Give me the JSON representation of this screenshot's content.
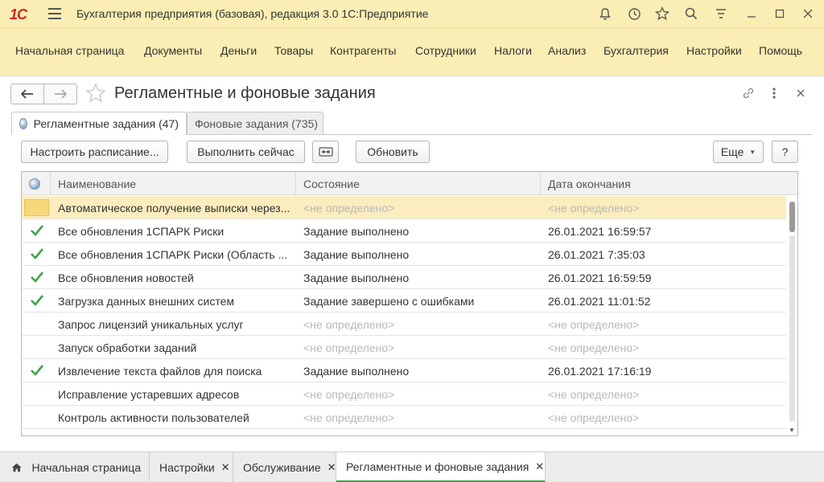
{
  "app": {
    "logo": "1С",
    "title": "Бухгалтерия предприятия (базовая), редакция 3.0 1С:Предприятие"
  },
  "mainmenu": {
    "items": [
      "Начальная страница",
      "Документы",
      "Деньги",
      "Товары",
      "Контрагенты",
      "Сотрудники",
      "Налоги",
      "Анализ",
      "Бухгалтерия",
      "Настройки",
      "Помощь"
    ]
  },
  "page": {
    "title": "Регламентные и фоновые задания"
  },
  "tabs": [
    {
      "label": "Регламентные задания (47)",
      "active": true
    },
    {
      "label": "Фоновые задания (735)",
      "active": false
    }
  ],
  "toolbar": {
    "schedule_label": "Настроить расписание...",
    "run_now_label": "Выполнить сейчас",
    "refresh_label": "Обновить",
    "more_label": "Еще",
    "help_label": "?"
  },
  "table": {
    "columns": [
      "Наименование",
      "Состояние",
      "Дата окончания"
    ],
    "rows": [
      {
        "done": false,
        "selected": true,
        "name": "Автоматическое получение выписки через...",
        "state": "<не определено>",
        "date": "<не определено>"
      },
      {
        "done": true,
        "selected": false,
        "name": "Все обновления 1СПАРК Риски",
        "state": "Задание выполнено",
        "date": "26.01.2021 16:59:57"
      },
      {
        "done": true,
        "selected": false,
        "name": "Все обновления 1СПАРК Риски (Область ...",
        "state": "Задание выполнено",
        "date": "26.01.2021 7:35:03"
      },
      {
        "done": true,
        "selected": false,
        "name": "Все обновления новостей",
        "state": "Задание выполнено",
        "date": "26.01.2021 16:59:59"
      },
      {
        "done": true,
        "selected": false,
        "name": "Загрузка данных внешних систем",
        "state": "Задание завершено с ошибками",
        "date": "26.01.2021 11:01:52"
      },
      {
        "done": false,
        "selected": false,
        "name": "Запрос лицензий уникальных услуг",
        "state": "<не определено>",
        "date": "<не определено>"
      },
      {
        "done": false,
        "selected": false,
        "name": "Запуск обработки заданий",
        "state": "<не определено>",
        "date": "<не определено>"
      },
      {
        "done": true,
        "selected": false,
        "name": "Извлечение текста файлов для поиска",
        "state": "Задание выполнено",
        "date": "26.01.2021 17:16:19"
      },
      {
        "done": false,
        "selected": false,
        "name": "Исправление устаревших адресов",
        "state": "<не определено>",
        "date": "<не определено>"
      },
      {
        "done": false,
        "selected": false,
        "name": "Контроль активности пользователей",
        "state": "<не определено>",
        "date": "<не определено>"
      }
    ]
  },
  "bottom_tabs": [
    {
      "label": "Начальная страница",
      "closable": false,
      "home": true,
      "active": false
    },
    {
      "label": "Настройки",
      "closable": true,
      "home": false,
      "active": false
    },
    {
      "label": "Обслуживание",
      "closable": true,
      "home": false,
      "active": false
    },
    {
      "label": "Регламентные и фоновые задания",
      "closable": true,
      "home": false,
      "active": true
    }
  ],
  "colors": {
    "accent_bar": "#fbeeb4",
    "selected_row": "#fbedbe",
    "check_green": "#3ea34a",
    "logo_red": "#d2232a"
  }
}
